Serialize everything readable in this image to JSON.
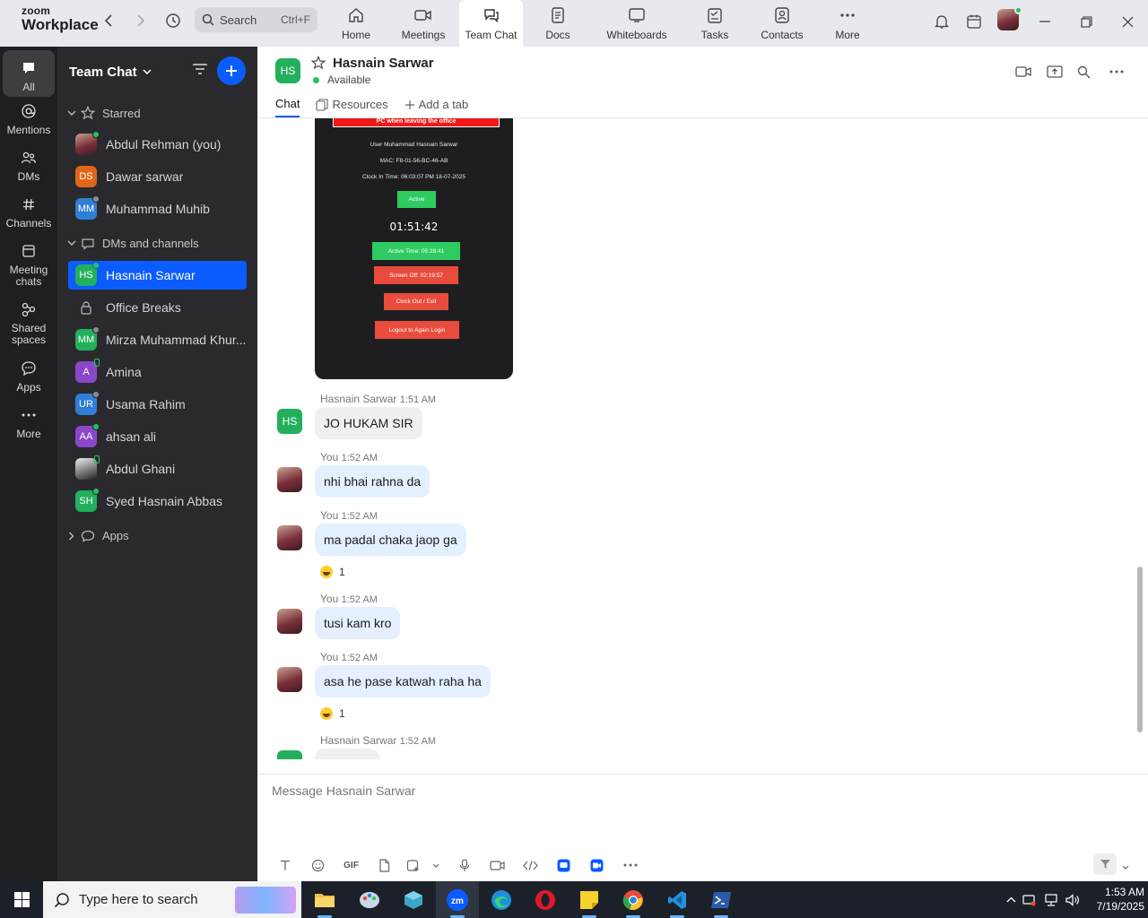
{
  "app": {
    "logo_line1": "zoom",
    "logo_line2": "Workplace"
  },
  "search": {
    "label": "Search",
    "shortcut": "Ctrl+F"
  },
  "top_tabs": [
    {
      "label": "Home",
      "icon": "home-icon"
    },
    {
      "label": "Meetings",
      "icon": "video-icon"
    },
    {
      "label": "Team Chat",
      "icon": "chat-icon",
      "active": true
    },
    {
      "label": "Docs",
      "icon": "doc-icon"
    },
    {
      "label": "Whiteboards",
      "icon": "whiteboard-icon"
    },
    {
      "label": "Tasks",
      "icon": "tasks-icon"
    },
    {
      "label": "Contacts",
      "icon": "contacts-icon"
    },
    {
      "label": "More",
      "icon": "more-icon"
    }
  ],
  "rail": [
    {
      "label": "All",
      "active": true
    },
    {
      "label": "Mentions"
    },
    {
      "label": "DMs"
    },
    {
      "label": "Channels"
    },
    {
      "label": "Meeting chats"
    },
    {
      "label": "Shared spaces"
    },
    {
      "label": "Apps"
    },
    {
      "label": "More"
    }
  ],
  "sidebar": {
    "title": "Team Chat",
    "starred_label": "Starred",
    "starred": [
      {
        "name": "Abdul Rehman (you)",
        "initials": "",
        "color": "",
        "status": "online"
      },
      {
        "name": "Dawar sarwar",
        "initials": "DS",
        "color": "#e0661a",
        "status": ""
      },
      {
        "name": "Muhammad Muhib",
        "initials": "MM",
        "color": "#2f7fd6",
        "status": "offline"
      }
    ],
    "dms_label": "DMs and channels",
    "dms": [
      {
        "name": "Hasnain Sarwar",
        "initials": "HS",
        "color": "#23b05c",
        "status": "online",
        "active": true
      },
      {
        "name": "Office Breaks",
        "initials": "",
        "color": "",
        "status": ""
      },
      {
        "name": "Mirza Muhammad Khur...",
        "initials": "MM",
        "color": "#23b05c",
        "status": "offline"
      },
      {
        "name": "Amina",
        "initials": "A",
        "color": "#8b47c9",
        "status": "phone"
      },
      {
        "name": "Usama Rahim",
        "initials": "UR",
        "color": "#2f7fd6",
        "status": "offline"
      },
      {
        "name": "ahsan ali",
        "initials": "AA",
        "color": "#8b47c9",
        "status": "online"
      },
      {
        "name": "Abdul Ghani",
        "initials": "",
        "color": "",
        "status": "phone"
      },
      {
        "name": "Syed Hasnain Abbas",
        "initials": "SH",
        "color": "#23b05c",
        "status": "online"
      }
    ],
    "apps_label": "Apps"
  },
  "chat": {
    "contact_name": "Hasnain Sarwar",
    "contact_initials": "HS",
    "status": "Available",
    "tabs": [
      "Chat",
      "Resources",
      "Add a tab"
    ],
    "screenshot": {
      "warning": "Note: Please press the Exit button and shut down your PC when leaving the office",
      "user": "User Muhammad Hasnain Sarwar",
      "mac": "MAC: F8-01-56-BC-46-AB",
      "clock_in": "Clock In Time: 06:03:07 PM 18-07-2025",
      "status_btn": "Active",
      "timer": "01:51:42",
      "active_time": "Active Time: 05:28:41",
      "screen_off": "Screen Off: 02:19:57",
      "clock_out": "Clock Out / Exit",
      "logout": "Logout to Again Login"
    },
    "messages": [
      {
        "sender": "Hasnain Sarwar",
        "time": "1:51 AM",
        "text": "JO HUKAM SIR",
        "dir": "in"
      },
      {
        "sender": "You",
        "time": "1:52 AM",
        "text": "nhi bhai rahna da",
        "dir": "out"
      },
      {
        "sender": "You",
        "time": "1:52 AM",
        "text": "ma padal chaka jaop ga",
        "dir": "out",
        "reaction_count": "1"
      },
      {
        "sender": "You",
        "time": "1:52 AM",
        "text": "tusi kam kro",
        "dir": "out"
      },
      {
        "sender": "You",
        "time": "1:52 AM",
        "text": "asa he pase katwah raha ha",
        "dir": "out",
        "reaction_count": "1"
      },
      {
        "sender": "Hasnain Sarwar",
        "time": "1:52 AM",
        "text": "",
        "dir": "in"
      }
    ],
    "composer_placeholder": "Message Hasnain Sarwar",
    "gif_label": "GIF"
  },
  "taskbar": {
    "search_placeholder": "Type here to search",
    "time": "1:53 AM",
    "date": "7/19/2025"
  },
  "colors": {
    "accent": "#0b5cff",
    "online": "#23c35d",
    "sidebar": "#2a2a2e",
    "rail": "#1f1f22"
  }
}
